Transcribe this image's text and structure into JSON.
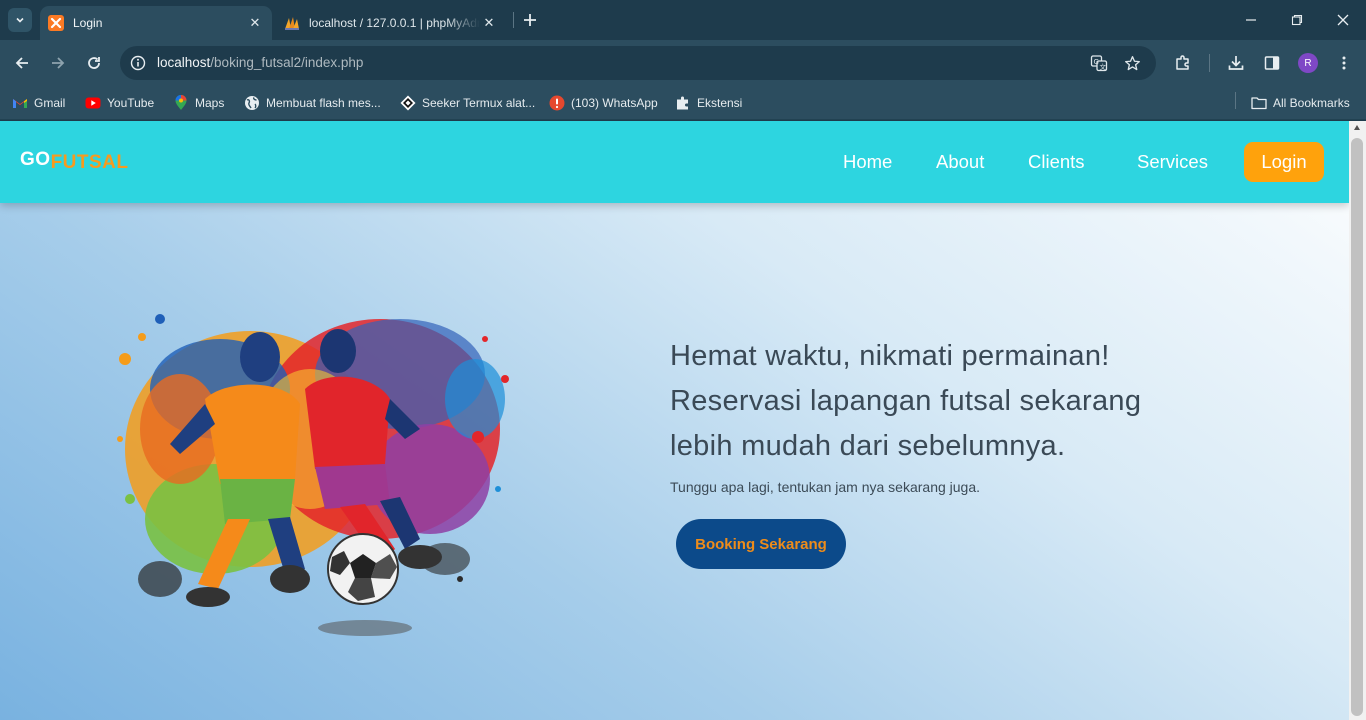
{
  "browser": {
    "tabs": [
      {
        "title": "Login",
        "active": true,
        "icon": "xampp-icon"
      },
      {
        "title": "localhost / 127.0.0.1 | phpMyAdmin",
        "active": false,
        "icon": "phpmyadmin-icon"
      }
    ],
    "url": {
      "host": "localhost",
      "path": "/boking_futsal2/index.php"
    },
    "profile_initial": "R",
    "bookmarks": [
      {
        "label": "Gmail",
        "icon": "gmail-icon"
      },
      {
        "label": "YouTube",
        "icon": "youtube-icon"
      },
      {
        "label": "Maps",
        "icon": "maps-icon"
      },
      {
        "label": "Membuat flash mes...",
        "icon": "globe-icon"
      },
      {
        "label": "Seeker Termux alat...",
        "icon": "seeker-icon"
      },
      {
        "label": "(103) WhatsApp",
        "icon": "alert-icon"
      },
      {
        "label": "Ekstensi",
        "icon": "puzzle-icon"
      }
    ],
    "all_bookmarks_label": "All Bookmarks"
  },
  "site": {
    "logo": {
      "part1": "GO",
      "part2": "FUTSAL"
    },
    "nav": [
      {
        "label": "Home"
      },
      {
        "label": "About"
      },
      {
        "label": "Clients"
      },
      {
        "label": "Services"
      }
    ],
    "login_label": "Login",
    "hero": {
      "heading_lines": [
        "Hemat waktu, nikmati permainan!",
        "Reservasi lapangan futsal sekarang",
        "lebih mudah dari sebelumnya."
      ],
      "subtitle": "Tunggu apa lagi, tentukan jam nya sekarang juga.",
      "cta_label": "Booking Sekarang"
    }
  },
  "colors": {
    "nav_bg": "#2dd5e0",
    "logo_accent": "#f79a1f",
    "login_bg": "#ffa20c",
    "cta_bg": "#0c4a8a",
    "cta_text": "#ee8c1a",
    "browser_frame": "#1e3b4c"
  }
}
